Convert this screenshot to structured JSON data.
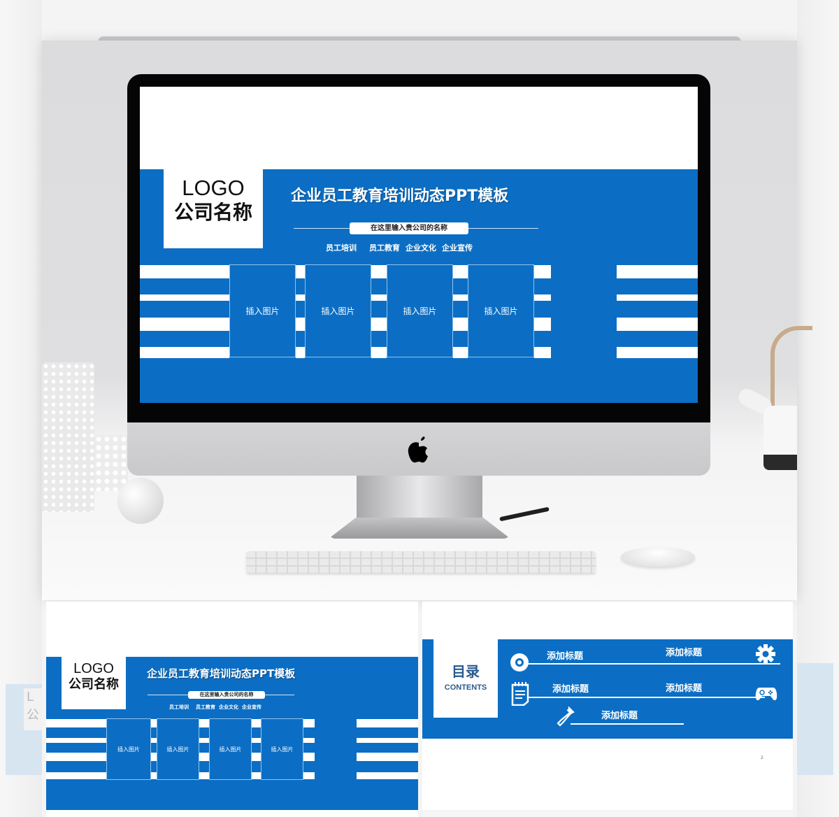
{
  "main_slide": {
    "logo": "LOGO",
    "company": "公司名称",
    "title": "企业员工教育培训动态PPT模板",
    "subtitle_pill": "在这里输入贵公司的名称",
    "tags": [
      "员工培训",
      "员工教育",
      "企业文化",
      "企业宣传"
    ],
    "image_placeholders": [
      "插入图片",
      "插入图片",
      "插入图片",
      "插入图片"
    ]
  },
  "thumbnail_cover": {
    "logo": "LOGO",
    "company": "公司名称",
    "title": "企业员工教育培训动态PPT模板",
    "subtitle_pill": "在这里输入贵公司的名称",
    "tags": [
      "员工培训",
      "员工教育",
      "企业文化",
      "企业宣传"
    ],
    "image_placeholders": [
      "插入图片",
      "插入图片",
      "插入图片",
      "插入图片"
    ]
  },
  "thumbnail_toc": {
    "title": "目录",
    "subtitle": "CONTENTS",
    "items": [
      {
        "label": "添加标题",
        "icon": "disc-icon"
      },
      {
        "label": "添加标题",
        "icon": "gear-icon"
      },
      {
        "label": "添加标题",
        "icon": "notepad-icon"
      },
      {
        "label": "添加标题",
        "icon": "gamepad-icon"
      },
      {
        "label": "添加标题",
        "icon": "eyedropper-icon"
      }
    ],
    "page_number": "2"
  },
  "ghost_left": {
    "logo_partial": "L",
    "company_partial": "公"
  },
  "colors": {
    "brand_blue": "#0b6ec4",
    "toc_text": "#2a5b8e",
    "bezel": "#050505"
  }
}
